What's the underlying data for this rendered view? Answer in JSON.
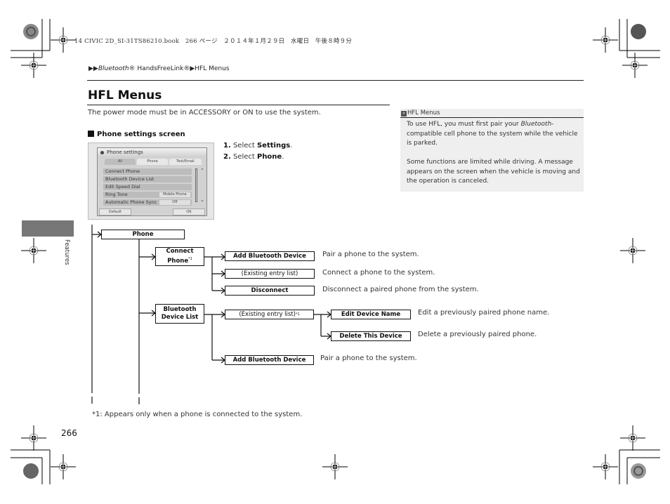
{
  "print_header": "14 CIVIC 2D_SI-31TS86210.book　266 ページ　２０１４年１月２９日　水曜日　午後８時９分",
  "breadcrumb": {
    "arrows": "▶▶",
    "part1": "Bluetooth",
    "part1_reg": "®",
    "part2": " HandsFreeLink®",
    "sep": "▶",
    "part3": "HFL Menus"
  },
  "page_title": "HFL Menus",
  "intro": "The power mode must be in ACCESSORY or ON to use the system.",
  "section_heading": "Phone settings screen",
  "steps": [
    {
      "num": "1.",
      "pre": " Select ",
      "bold": "Settings",
      "post": "."
    },
    {
      "num": "2.",
      "pre": " Select ",
      "bold": "Phone",
      "post": "."
    }
  ],
  "screen": {
    "title": "Phone settings",
    "tabs": [
      "All",
      "Phone",
      "Text/Email"
    ],
    "rows": [
      {
        "label": "Connect Phone",
        "value": ""
      },
      {
        "label": "Bluetooth Device List",
        "value": ""
      },
      {
        "label": "Edit Speed Dial",
        "value": ""
      },
      {
        "label": "Ring Tone",
        "value": "Mobile Phone"
      },
      {
        "label": "Automatic Phone Sync",
        "value": "Off"
      }
    ],
    "scroll_up": "⌃",
    "scroll_down": "⌄",
    "buttons": {
      "default": "Default",
      "ok": "OK"
    }
  },
  "note": {
    "icon": "»",
    "title": "HFL Menus",
    "p1_pre": "To use HFL, you must first pair your ",
    "p1_italic": "Bluetooth",
    "p1_post": "-compatible cell phone to the system while the vehicle is parked.",
    "p2": "Some functions are limited while driving. A message appears on the screen when the vehicle is moving and the operation is canceled."
  },
  "side_tab_label": "Features",
  "tree": {
    "root": "Phone",
    "connect_phone": {
      "line1": "Connect",
      "line2": "Phone",
      "sup": "*1"
    },
    "connect_children": [
      {
        "label": "Add Bluetooth Device",
        "desc": "Pair a phone to the system."
      },
      {
        "label": "(Existing entry list)",
        "desc": "Connect a phone to the system."
      },
      {
        "label": "Disconnect",
        "desc": "Disconnect a paired phone from the system."
      }
    ],
    "device_list": {
      "line1": "Bluetooth",
      "line2": "Device List"
    },
    "existing_entry": {
      "label": "(Existing entry list)",
      "sup": "*1"
    },
    "existing_children": [
      {
        "label": "Edit Device Name",
        "desc": "Edit a previously paired phone name."
      },
      {
        "label": "Delete This Device",
        "desc": "Delete a previously paired phone."
      }
    ],
    "add_device": {
      "label": "Add Bluetooth Device",
      "desc": "Pair a phone to the system."
    }
  },
  "footnote": "*1: Appears only when a phone is connected to the system.",
  "page_number": "266"
}
